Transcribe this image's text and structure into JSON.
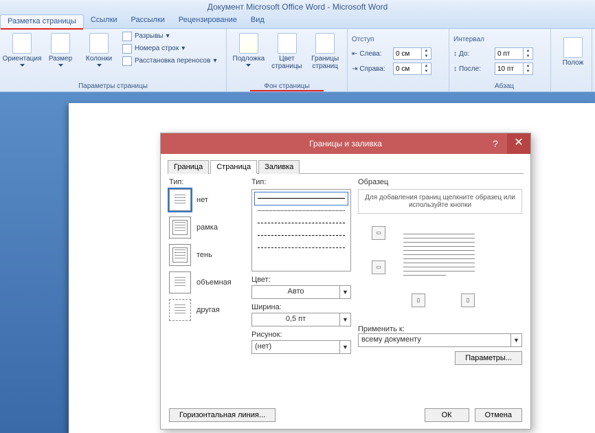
{
  "titlebar": "Документ Microsoft Office Word - Microsoft Word",
  "tabs": {
    "layout": "Разметка страницы",
    "links": "Ссылки",
    "mailings": "Рассылки",
    "review": "Рецензирование",
    "view": "Вид"
  },
  "ribbon": {
    "pageSetup": {
      "orientation": "Ориентация",
      "size": "Размер",
      "columns": "Колонки",
      "breaks": "Разрывы",
      "lineNumbers": "Номера строк",
      "hyphenation": "Расстановка переносов",
      "groupTitle": "Параметры страницы"
    },
    "pageBg": {
      "watermark": "Подложка",
      "pageColor": "Цвет\nстраницы",
      "borders": "Границы\nстраниц",
      "groupTitle": "Фон страницы"
    },
    "indent": {
      "header": "Отступ",
      "left": "Слева:",
      "right": "Справа:",
      "leftVal": "0 см",
      "rightVal": "0 см"
    },
    "spacing": {
      "header": "Интервал",
      "before": "До:",
      "after": "После:",
      "beforeVal": "0 пт",
      "afterVal": "10 пт"
    },
    "paragraph": "Абзац",
    "arrange": "Полож"
  },
  "dialog": {
    "title": "Границы и заливка",
    "tabs": {
      "border": "Граница",
      "page": "Страница",
      "fill": "Заливка"
    },
    "typeHdr": "Тип:",
    "types": {
      "none": "нет",
      "box": "рамка",
      "shadow": "тень",
      "threeD": "объемная",
      "custom": "другая"
    },
    "lineHdr": "Тип:",
    "colorLbl": "Цвет:",
    "colorVal": "Авто",
    "widthLbl": "Ширина:",
    "widthVal": "0,5 пт",
    "artLbl": "Рисунок:",
    "artVal": "(нет)",
    "prevHdr": "Образец",
    "prevHint": "Для добавления границ щелкните образец или используйте кнопки",
    "applyLbl": "Применить к:",
    "applyVal": "всему документу",
    "params": "Параметры...",
    "hline": "Горизонтальная линия...",
    "ok": "ОК",
    "cancel": "Отмена"
  }
}
